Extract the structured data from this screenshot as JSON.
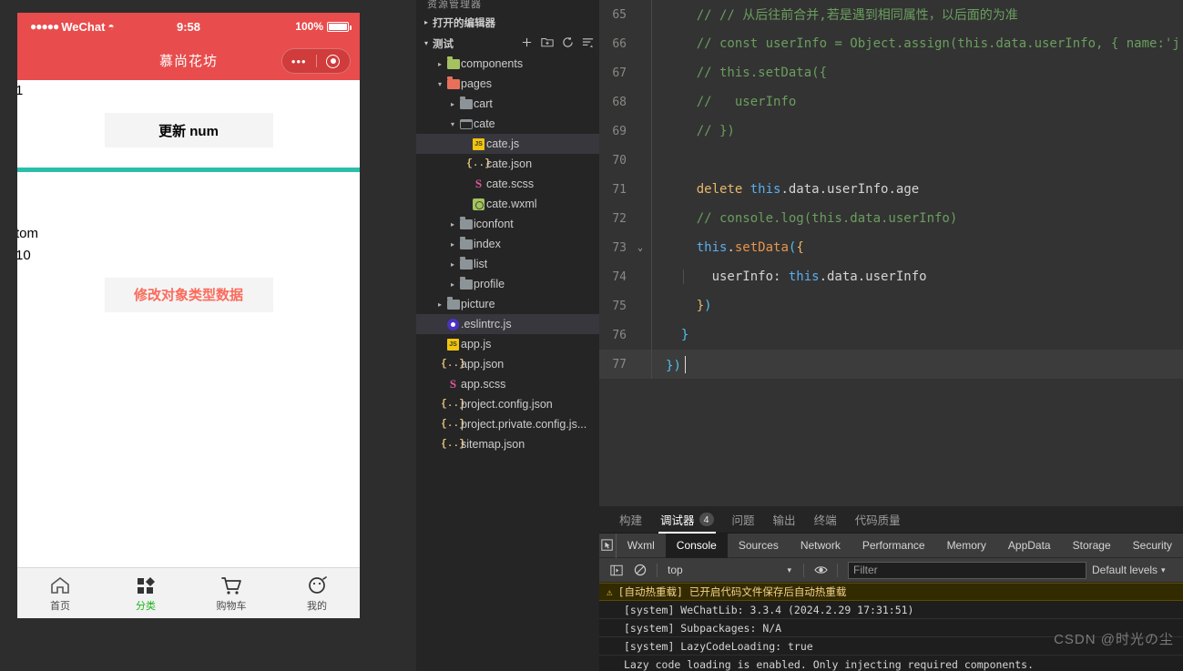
{
  "simulator": {
    "status_bar": {
      "carrier": "WeChat",
      "signal_dots": "●●●●●",
      "wifi": "≈",
      "time": "9:58",
      "battery_text": "100%"
    },
    "nav_bar": {
      "title": "慕尚花坊",
      "capsule_dots": "•••"
    },
    "page": {
      "num_value": "1",
      "update_num_button": "更新 num",
      "user_name": "tom",
      "user_age": "10",
      "modify_object_button": "修改对象类型数据"
    },
    "tabbar": [
      {
        "label": "首页",
        "icon": "home-icon",
        "active": false
      },
      {
        "label": "分类",
        "icon": "category-icon",
        "active": true
      },
      {
        "label": "购物车",
        "icon": "cart-icon",
        "active": false
      },
      {
        "label": "我的",
        "icon": "profile-icon",
        "active": false
      }
    ],
    "active_color": "#18b718",
    "theme_color": "#e84c4c",
    "divider_color": "#2bbfa9"
  },
  "explorer": {
    "panel_title": "资源管理器",
    "open_editors_label": "打开的编辑器",
    "project_name": "测试",
    "actions": [
      "new-file-icon",
      "new-folder-icon",
      "refresh-icon",
      "collapse-all-icon"
    ],
    "tree": [
      {
        "label": "components",
        "icon": "folder-icon",
        "depth": 1,
        "twisty": "▸",
        "selected": false
      },
      {
        "label": "pages",
        "icon": "folder-open-icon",
        "depth": 1,
        "twisty": "▾",
        "selected": false
      },
      {
        "label": "cart",
        "icon": "folder-icon",
        "depth": 2,
        "twisty": "▸",
        "selected": false
      },
      {
        "label": "cate",
        "icon": "folder-open-icon",
        "depth": 2,
        "twisty": "▾",
        "selected": false
      },
      {
        "label": "cate.js",
        "icon": "js-file-icon",
        "depth": 3,
        "twisty": "",
        "selected": true
      },
      {
        "label": "cate.json",
        "icon": "json-file-icon",
        "depth": 3,
        "twisty": "",
        "selected": false
      },
      {
        "label": "cate.scss",
        "icon": "scss-file-icon",
        "depth": 3,
        "twisty": "",
        "selected": false
      },
      {
        "label": "cate.wxml",
        "icon": "wxml-file-icon",
        "depth": 3,
        "twisty": "",
        "selected": false
      },
      {
        "label": "iconfont",
        "icon": "folder-icon",
        "depth": 2,
        "twisty": "▸",
        "selected": false
      },
      {
        "label": "index",
        "icon": "folder-icon",
        "depth": 2,
        "twisty": "▸",
        "selected": false
      },
      {
        "label": "list",
        "icon": "folder-icon",
        "depth": 2,
        "twisty": "▸",
        "selected": false
      },
      {
        "label": "profile",
        "icon": "folder-icon",
        "depth": 2,
        "twisty": "▸",
        "selected": false
      },
      {
        "label": "picture",
        "icon": "folder-icon",
        "depth": 1,
        "twisty": "▸",
        "selected": false
      },
      {
        "label": ".eslintrc.js",
        "icon": "eslint-file-icon",
        "depth": 1,
        "twisty": "",
        "selected": true
      },
      {
        "label": "app.js",
        "icon": "js-file-icon",
        "depth": 1,
        "twisty": "",
        "selected": false
      },
      {
        "label": "app.json",
        "icon": "json-file-icon",
        "depth": 1,
        "twisty": "",
        "selected": false
      },
      {
        "label": "app.scss",
        "icon": "scss-file-icon",
        "depth": 1,
        "twisty": "",
        "selected": false
      },
      {
        "label": "project.config.json",
        "icon": "json-file-icon",
        "depth": 1,
        "twisty": "",
        "selected": false
      },
      {
        "label": "project.private.config.js...",
        "icon": "json-file-icon",
        "depth": 1,
        "twisty": "",
        "selected": false
      },
      {
        "label": "sitemap.json",
        "icon": "json-file-icon",
        "depth": 1,
        "twisty": "",
        "selected": false
      }
    ]
  },
  "editor": {
    "lines": [
      {
        "no": "65",
        "fold": "",
        "current": false,
        "guide": false,
        "tokens": [
          {
            "t": "    // // 从后往前合并,若是遇到相同属性，以后面的为准",
            "c": "c-com"
          }
        ]
      },
      {
        "no": "66",
        "fold": "",
        "current": false,
        "guide": false,
        "tokens": [
          {
            "t": "    // const userInfo = Object.assign(this.data.userInfo, { name:'j",
            "c": "c-com"
          }
        ]
      },
      {
        "no": "67",
        "fold": "",
        "current": false,
        "guide": false,
        "tokens": [
          {
            "t": "    // this.setData({",
            "c": "c-com"
          }
        ]
      },
      {
        "no": "68",
        "fold": "",
        "current": false,
        "guide": false,
        "tokens": [
          {
            "t": "    //   userInfo",
            "c": "c-com"
          }
        ]
      },
      {
        "no": "69",
        "fold": "",
        "current": false,
        "guide": false,
        "tokens": [
          {
            "t": "    // })",
            "c": "c-com"
          }
        ]
      },
      {
        "no": "70",
        "fold": "",
        "current": false,
        "guide": false,
        "tokens": [
          {
            "t": "",
            "c": "c-id"
          }
        ]
      },
      {
        "no": "71",
        "fold": "",
        "current": false,
        "guide": false,
        "tokens": [
          {
            "t": "    ",
            "c": "c-id"
          },
          {
            "t": "delete",
            "c": "c-kw"
          },
          {
            "t": " ",
            "c": "c-id"
          },
          {
            "t": "this",
            "c": "c-this"
          },
          {
            "t": ".data.userInfo.age",
            "c": "c-id"
          }
        ]
      },
      {
        "no": "72",
        "fold": "",
        "current": false,
        "guide": false,
        "tokens": [
          {
            "t": "    // console.log(this.data.userInfo)",
            "c": "c-com"
          }
        ]
      },
      {
        "no": "73",
        "fold": "⌄",
        "current": false,
        "guide": false,
        "tokens": [
          {
            "t": "    ",
            "c": "c-id"
          },
          {
            "t": "this",
            "c": "c-this"
          },
          {
            "t": ".",
            "c": "c-id"
          },
          {
            "t": "setData",
            "c": "c-fn"
          },
          {
            "t": "(",
            "c": "c-pun"
          },
          {
            "t": "{",
            "c": "c-kw"
          }
        ]
      },
      {
        "no": "74",
        "fold": "",
        "current": false,
        "guide": true,
        "tokens": [
          {
            "t": "      userInfo: ",
            "c": "c-id"
          },
          {
            "t": "this",
            "c": "c-this"
          },
          {
            "t": ".data.userInfo",
            "c": "c-id"
          }
        ]
      },
      {
        "no": "75",
        "fold": "",
        "current": false,
        "guide": false,
        "tokens": [
          {
            "t": "    ",
            "c": "c-id"
          },
          {
            "t": "}",
            "c": "c-kw"
          },
          {
            "t": ")",
            "c": "c-pun"
          }
        ]
      },
      {
        "no": "76",
        "fold": "",
        "current": false,
        "guide": false,
        "tokens": [
          {
            "t": "  ",
            "c": "c-id"
          },
          {
            "t": "}",
            "c": "c-pun"
          }
        ]
      },
      {
        "no": "77",
        "fold": "",
        "current": true,
        "guide": false,
        "tokens": [
          {
            "t": "}",
            "c": "c-pun"
          },
          {
            "t": ")",
            "c": "c-pun"
          }
        ]
      }
    ]
  },
  "devtools": {
    "panel_tabs": [
      {
        "label": "构建",
        "count": "",
        "active": false
      },
      {
        "label": "调试器",
        "count": "4",
        "active": true
      },
      {
        "label": "问题",
        "count": "",
        "active": false
      },
      {
        "label": "输出",
        "count": "",
        "active": false
      },
      {
        "label": "终端",
        "count": "",
        "active": false
      },
      {
        "label": "代码质量",
        "count": "",
        "active": false
      }
    ],
    "inspector_tabs": [
      {
        "label": "Wxml",
        "active": false
      },
      {
        "label": "Console",
        "active": true
      },
      {
        "label": "Sources",
        "active": false
      },
      {
        "label": "Network",
        "active": false
      },
      {
        "label": "Performance",
        "active": false
      },
      {
        "label": "Memory",
        "active": false
      },
      {
        "label": "AppData",
        "active": false
      },
      {
        "label": "Storage",
        "active": false
      },
      {
        "label": "Security",
        "active": false
      }
    ],
    "toolbar": {
      "context": "top",
      "filter_placeholder": "Filter",
      "levels_label": "Default levels"
    },
    "console_rows": [
      {
        "text": "[自动热重载] 已开启代码文件保存后自动热重载",
        "type": "warning",
        "indent": false
      },
      {
        "text": "[system] WeChatLib: 3.3.4 (2024.2.29 17:31:51)",
        "type": "log",
        "indent": true
      },
      {
        "text": "[system] Subpackages: N/A",
        "type": "log",
        "indent": true
      },
      {
        "text": "[system] LazyCodeLoading: true",
        "type": "log",
        "indent": true
      },
      {
        "text": "Lazy code loading is enabled. Only injecting required components.",
        "type": "log",
        "indent": true
      }
    ],
    "watermark": "CSDN @时光の尘"
  }
}
